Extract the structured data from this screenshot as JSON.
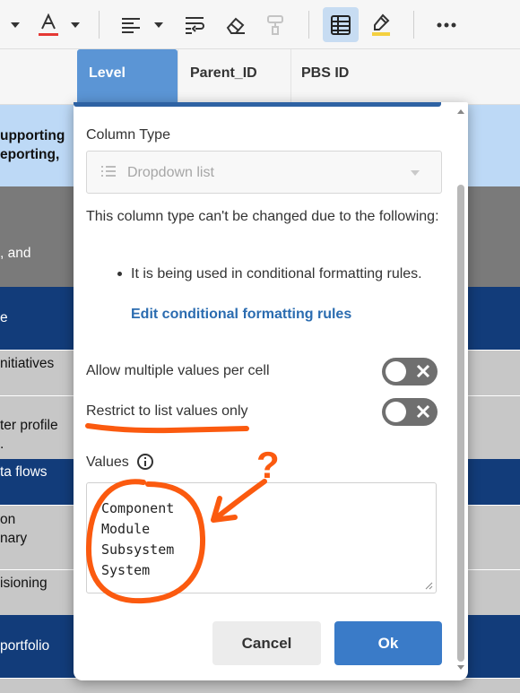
{
  "toolbar": {
    "icons": [
      "chevron-down-icon",
      "text-color-icon",
      "chevron-down-icon",
      "align-left-icon",
      "chevron-down-icon",
      "wrap-text-icon",
      "eraser-icon",
      "format-painter-icon",
      "grid-view-icon",
      "highlight-icon",
      "more-icon"
    ],
    "text_color": "#e53935"
  },
  "columns": {
    "level": "Level",
    "parent_id": "Parent_ID",
    "pbs_id": "PBS ID"
  },
  "rows": [
    {
      "lines": [
        "upporting",
        "eporting,"
      ]
    },
    {
      "lines": [
        ", and"
      ]
    },
    {
      "lines": [
        "e"
      ]
    },
    {
      "lines": [
        "nitiatives"
      ]
    },
    {
      "lines": [
        "ter profile",
        "."
      ]
    },
    {
      "lines": [
        "ta flows"
      ]
    },
    {
      "lines": [
        "on",
        "nary"
      ]
    },
    {
      "lines": [
        "isioning"
      ]
    },
    {
      "lines": [
        "portfolio"
      ]
    }
  ],
  "dialog": {
    "column_type_label": "Column Type",
    "column_type_value": "Dropdown list",
    "cannot_change_text": "This column type can't be changed due to the following:",
    "bullet_text": "It is being used in conditional formatting rules.",
    "edit_link": "Edit conditional formatting rules",
    "allow_multiple_label": "Allow multiple values per cell",
    "restrict_label": "Restrict to list values only",
    "values_label": "Values",
    "values": [
      "Component",
      "Module",
      "Subsystem",
      "System"
    ],
    "cancel_label": "Cancel",
    "ok_label": "Ok",
    "allow_multiple_on": false,
    "restrict_on": false
  },
  "annotation": {
    "question_mark": "?",
    "color": "#fb5a0f"
  }
}
